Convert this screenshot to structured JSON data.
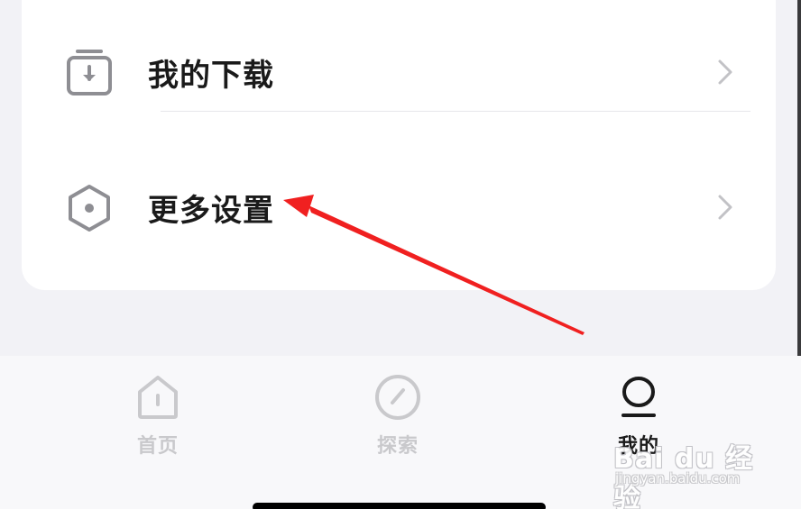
{
  "menu": {
    "items": [
      {
        "label": "我的下载",
        "icon": "download-icon"
      },
      {
        "label": "更多设置",
        "icon": "settings-hexagon-icon"
      }
    ]
  },
  "tabbar": {
    "tabs": [
      {
        "label": "首页",
        "icon": "home-icon",
        "active": false
      },
      {
        "label": "探索",
        "icon": "compass-icon",
        "active": false
      },
      {
        "label": "我的",
        "icon": "profile-icon",
        "active": true
      }
    ]
  },
  "watermark": {
    "main": "Bai du 经验",
    "sub": "jingyan.baidu.com"
  },
  "colors": {
    "background": "#f2f2f6",
    "card": "#ffffff",
    "annotation_arrow": "#f02020",
    "text_primary": "#1a1a1a",
    "tab_inactive": "#c9c9cc",
    "icon_gray": "#8e8e93"
  }
}
